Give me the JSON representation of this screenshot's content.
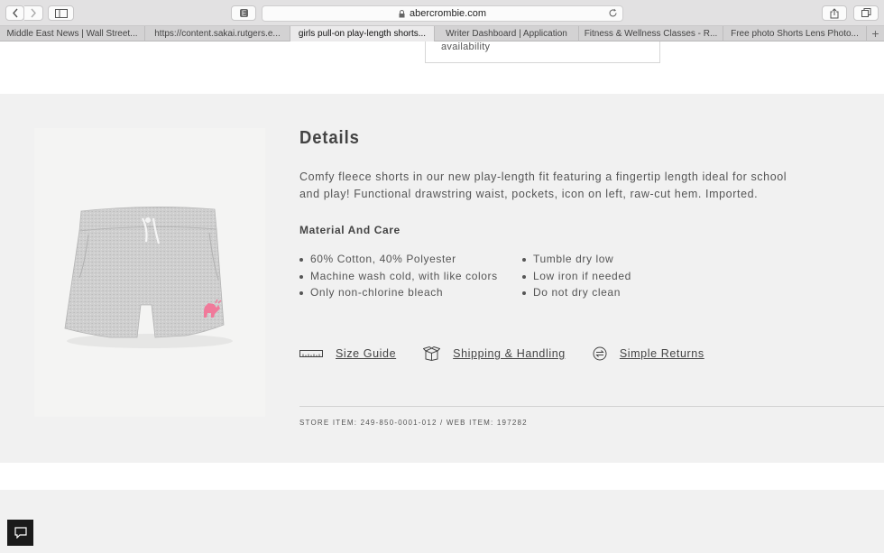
{
  "browser": {
    "url": "abercrombie.com",
    "tabs": [
      {
        "label": "Middle East News | Wall Street..."
      },
      {
        "label": "https://content.sakai.rutgers.e..."
      },
      {
        "label": "girls pull-on play-length shorts..."
      },
      {
        "label": "Writer Dashboard | Application"
      },
      {
        "label": "Fitness & Wellness Classes - R..."
      },
      {
        "label": "Free photo Shorts Lens Photo..."
      }
    ],
    "active_tab": 2
  },
  "availability": {
    "text": "availability"
  },
  "details": {
    "title": "Details",
    "description": "Comfy fleece shorts in our new play-length fit featuring a fingertip length ideal for school and play! Functional drawstring waist, pockets, icon on left, raw-cut hem. Imported.",
    "material_title": "Material And Care",
    "care_left": [
      "60% Cotton, 40% Polyester",
      "Machine wash cold, with like colors",
      "Only non-chlorine bleach"
    ],
    "care_right": [
      "Tumble dry low",
      "Low iron if needed",
      "Do not dry clean"
    ],
    "links": {
      "size_guide": "Size Guide",
      "shipping": "Shipping & Handling",
      "returns": "Simple Returns"
    },
    "item_numbers": "STORE ITEM: 249-850-0001-012  /  WEB ITEM: 197282"
  },
  "colors": {
    "section_bg": "#f1f1f1",
    "text": "#444444",
    "moose_logo": "#f07a9a"
  }
}
